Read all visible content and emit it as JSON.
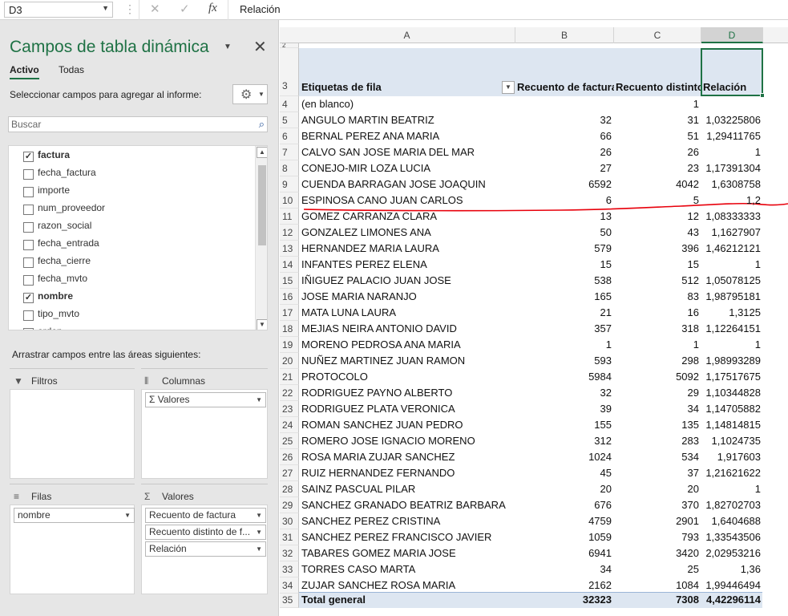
{
  "formula_bar": {
    "cell_ref": "D3",
    "content": "Relación"
  },
  "pivot_panel": {
    "title": "Campos de tabla dinámica",
    "tabs": [
      {
        "label": "Activo",
        "active": true
      },
      {
        "label": "Todas",
        "active": false
      }
    ],
    "select_prompt": "Seleccionar campos para agregar al informe:",
    "search_placeholder": "Buscar",
    "fields": [
      {
        "name": "factura",
        "checked": true
      },
      {
        "name": "fecha_factura",
        "checked": false
      },
      {
        "name": "importe",
        "checked": false
      },
      {
        "name": "num_proveedor",
        "checked": false
      },
      {
        "name": "razon_social",
        "checked": false
      },
      {
        "name": "fecha_entrada",
        "checked": false
      },
      {
        "name": "fecha_cierre",
        "checked": false
      },
      {
        "name": "fecha_mvto",
        "checked": false
      },
      {
        "name": "nombre",
        "checked": true
      },
      {
        "name": "tipo_mvto",
        "checked": false
      },
      {
        "name": "orden",
        "checked": false
      }
    ],
    "drag_prompt": "Arrastrar campos entre las áreas siguientes:",
    "areas": {
      "filters": {
        "label": "Filtros",
        "items": []
      },
      "columns": {
        "label": "Columnas",
        "items": [
          "Σ  Valores"
        ]
      },
      "rows": {
        "label": "Filas",
        "items": [
          "nombre"
        ]
      },
      "values": {
        "label": "Valores",
        "items": [
          "Recuento de factura",
          "Recuento distinto de f...",
          "Relación"
        ]
      }
    }
  },
  "sheet": {
    "columns": [
      "A",
      "B",
      "C",
      "D"
    ],
    "selected_column": "D",
    "header_row_number": "3",
    "partial_row_number": "2",
    "headers": [
      "Etiquetas de fila",
      "Recuento de factura",
      "Recuento distinto",
      "Relación"
    ],
    "rows": [
      {
        "n": "4",
        "name": "(en blanco)",
        "b": "",
        "c": "1",
        "d": ""
      },
      {
        "n": "5",
        "name": "ANGULO MARTIN BEATRIZ",
        "b": "32",
        "c": "31",
        "d": "1,03225806"
      },
      {
        "n": "6",
        "name": "BERNAL PEREZ ANA MARIA",
        "b": "66",
        "c": "51",
        "d": "1,29411765"
      },
      {
        "n": "7",
        "name": "CALVO SAN JOSE MARIA DEL MAR",
        "b": "26",
        "c": "26",
        "d": "1"
      },
      {
        "n": "8",
        "name": "CONEJO-MIR LOZA LUCIA",
        "b": "27",
        "c": "23",
        "d": "1,17391304"
      },
      {
        "n": "9",
        "name": "CUENDA BARRAGAN JOSE JOAQUIN",
        "b": "6592",
        "c": "4042",
        "d": "1,6308758"
      },
      {
        "n": "10",
        "name": "ESPINOSA  CANO JUAN CARLOS",
        "b": "6",
        "c": "5",
        "d": "1,2"
      },
      {
        "n": "11",
        "name": "GOMEZ CARRANZA CLARA",
        "b": "13",
        "c": "12",
        "d": "1,08333333"
      },
      {
        "n": "12",
        "name": "GONZALEZ LIMONES ANA",
        "b": "50",
        "c": "43",
        "d": "1,1627907"
      },
      {
        "n": "13",
        "name": "HERNANDEZ MARIA LAURA",
        "b": "579",
        "c": "396",
        "d": "1,46212121"
      },
      {
        "n": "14",
        "name": "INFANTES PEREZ ELENA",
        "b": "15",
        "c": "15",
        "d": "1"
      },
      {
        "n": "15",
        "name": "IÑIGUEZ PALACIO JUAN JOSE",
        "b": "538",
        "c": "512",
        "d": "1,05078125"
      },
      {
        "n": "16",
        "name": "JOSE MARIA NARANJO",
        "b": "165",
        "c": "83",
        "d": "1,98795181"
      },
      {
        "n": "17",
        "name": "MATA LUNA LAURA",
        "b": "21",
        "c": "16",
        "d": "1,3125"
      },
      {
        "n": "18",
        "name": "MEJIAS NEIRA ANTONIO DAVID",
        "b": "357",
        "c": "318",
        "d": "1,12264151"
      },
      {
        "n": "19",
        "name": "MORENO PEDROSA ANA MARIA",
        "b": "1",
        "c": "1",
        "d": "1"
      },
      {
        "n": "20",
        "name": "NUÑEZ MARTINEZ JUAN RAMON",
        "b": "593",
        "c": "298",
        "d": "1,98993289"
      },
      {
        "n": "21",
        "name": "PROTOCOLO",
        "b": "5984",
        "c": "5092",
        "d": "1,17517675"
      },
      {
        "n": "22",
        "name": "RODRIGUEZ PAYNO ALBERTO",
        "b": "32",
        "c": "29",
        "d": "1,10344828"
      },
      {
        "n": "23",
        "name": "RODRIGUEZ PLATA VERONICA",
        "b": "39",
        "c": "34",
        "d": "1,14705882"
      },
      {
        "n": "24",
        "name": "ROMAN SANCHEZ JUAN PEDRO",
        "b": "155",
        "c": "135",
        "d": "1,14814815"
      },
      {
        "n": "25",
        "name": "ROMERO JOSE IGNACIO MORENO",
        "b": "312",
        "c": "283",
        "d": "1,1024735"
      },
      {
        "n": "26",
        "name": "ROSA MARIA ZUJAR SANCHEZ",
        "b": "1024",
        "c": "534",
        "d": "1,917603"
      },
      {
        "n": "27",
        "name": "RUIZ HERNANDEZ FERNANDO",
        "b": "45",
        "c": "37",
        "d": "1,21621622"
      },
      {
        "n": "28",
        "name": "SAINZ PASCUAL PILAR",
        "b": "20",
        "c": "20",
        "d": "1"
      },
      {
        "n": "29",
        "name": "SANCHEZ GRANADO BEATRIZ BARBARA",
        "b": "676",
        "c": "370",
        "d": "1,82702703"
      },
      {
        "n": "30",
        "name": "SANCHEZ PEREZ CRISTINA",
        "b": "4759",
        "c": "2901",
        "d": "1,6404688"
      },
      {
        "n": "31",
        "name": "SANCHEZ PEREZ FRANCISCO JAVIER",
        "b": "1059",
        "c": "793",
        "d": "1,33543506"
      },
      {
        "n": "32",
        "name": "TABARES GOMEZ MARIA JOSE",
        "b": "6941",
        "c": "3420",
        "d": "2,02953216"
      },
      {
        "n": "33",
        "name": "TORRES CASO MARTA",
        "b": "34",
        "c": "25",
        "d": "1,36"
      },
      {
        "n": "34",
        "name": "ZUJAR SANCHEZ ROSA MARIA",
        "b": "2162",
        "c": "1084",
        "d": "1,99446494"
      }
    ],
    "total": {
      "n": "35",
      "name": "Total general",
      "b": "32323",
      "c": "7308",
      "d": "4,42296114"
    },
    "accent": "#1f7245",
    "header_band": "#dde6f1",
    "annotation_color": "#e8000b"
  }
}
